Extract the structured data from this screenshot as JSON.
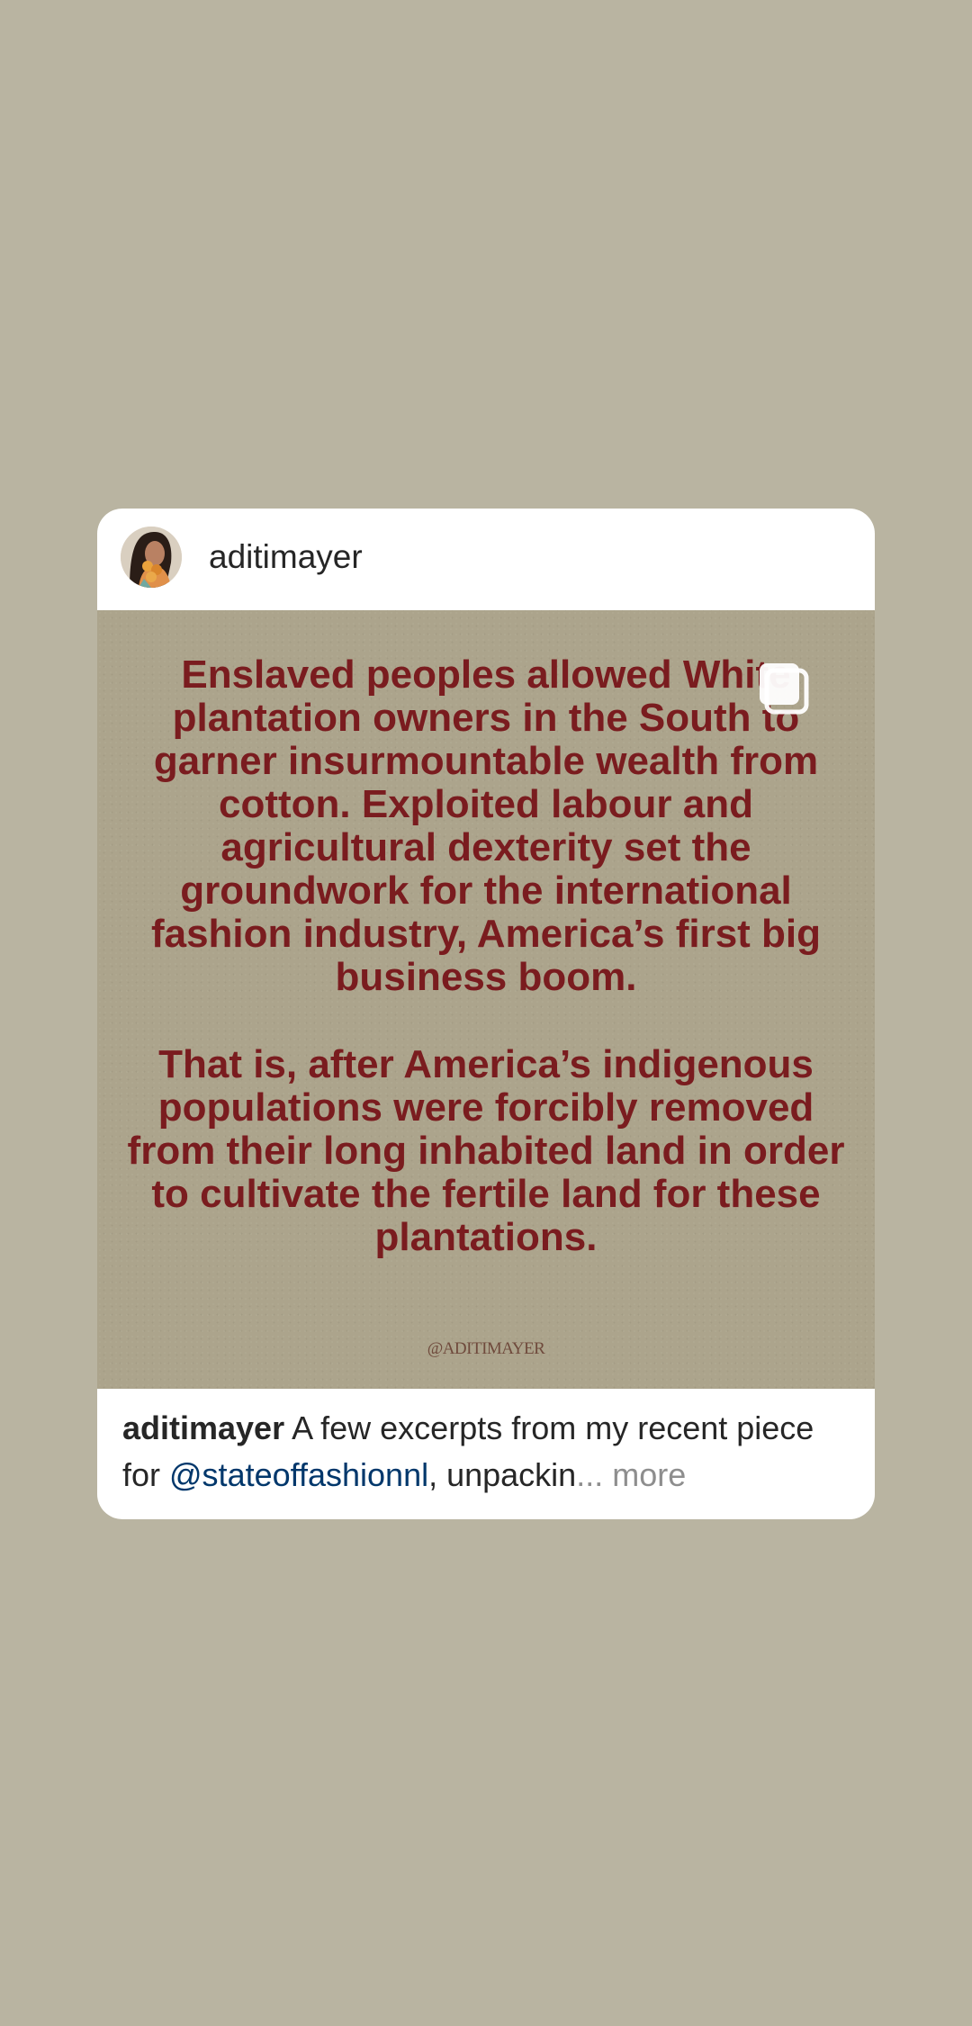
{
  "post": {
    "username": "aditimayer",
    "quote_paragraph_1": "Enslaved peoples allowed White plantation owners in the South to garner insurmountable wealth from cotton. Exploited labour and agricultural dexterity set the groundwork for the international fashion industry, America’s first big business boom.",
    "quote_paragraph_2": "That is, after America’s indigenous populations were forcibly removed from their long inhabited land in order to cultivate the fertile land for these plantations.",
    "watermark": "@ADITIMAYER",
    "caption": {
      "username": "aditimayer",
      "text_before_mention": " A few excerpts from my recent piece for ",
      "mention": "@stateoffashionnl",
      "text_after_mention": ", unpackin",
      "ellipsis": "...",
      "more_label": " more"
    },
    "icons": {
      "avatar": "profile-photo",
      "multi_post": "carousel-icon"
    },
    "colors": {
      "background": "#b9b4a1",
      "quote_text": "#7a1c1f",
      "mention": "#00376b",
      "more": "#8e8e8e"
    }
  }
}
